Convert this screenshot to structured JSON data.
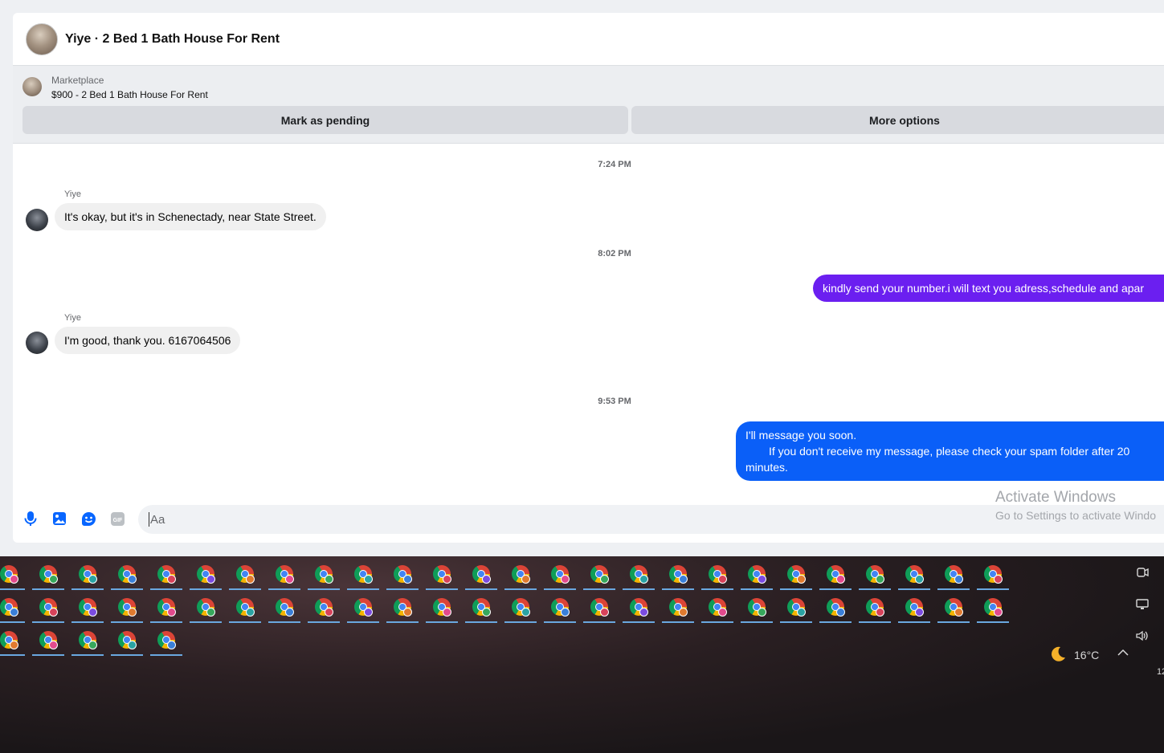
{
  "chat": {
    "title": "Yiye · 2 Bed 1 Bath House For Rent",
    "listing": {
      "source": "Marketplace",
      "title": "$900 - 2 Bed 1 Bath House For Rent",
      "mark_pending": "Mark as pending",
      "more_options": "More options"
    },
    "timestamps": [
      "7:24 PM",
      "8:02 PM",
      "9:53 PM"
    ],
    "messages": [
      {
        "sender": "Yiye",
        "text": "It's okay, but it's in Schenectady, near State Street."
      },
      {
        "text": "kindly send your number.i will text you adress,schedule and apar"
      },
      {
        "sender": "Yiye",
        "text": "I'm good, thank you. 6167064506"
      },
      {
        "line1": "I'll message you soon.",
        "line2": "If you don't receive my message, please check your spam folder after 20",
        "line3": "minutes."
      }
    ],
    "composer": {
      "placeholder": "Aa"
    }
  },
  "watermark": {
    "line1": "Activate Windows",
    "line2": "Go to Settings to activate Windo"
  },
  "taskbar": {
    "weather": "16°C",
    "clock_fragment": "12",
    "badge_colors": [
      "#e24a8d",
      "#7b4be0",
      "#3a7fd8",
      "#37a85c",
      "#e07a2f",
      "#d8425a",
      "#2aa3a3"
    ]
  }
}
